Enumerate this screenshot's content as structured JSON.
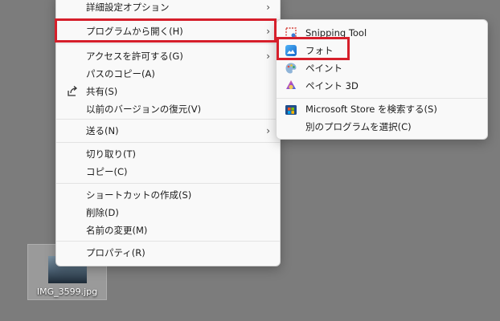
{
  "main_menu": {
    "items": [
      {
        "label": "詳細設定オプション",
        "has_submenu": true
      },
      {
        "label": "プログラムから開く(H)",
        "has_submenu": true
      },
      {
        "label": "アクセスを許可する(G)",
        "has_submenu": true
      },
      {
        "label": "パスのコピー(A)"
      },
      {
        "label": "共有(S)",
        "icon": "share-icon"
      },
      {
        "label": "以前のバージョンの復元(V)"
      },
      {
        "label": "送る(N)",
        "has_submenu": true
      },
      {
        "label": "切り取り(T)"
      },
      {
        "label": "コピー(C)"
      },
      {
        "label": "ショートカットの作成(S)"
      },
      {
        "label": "削除(D)"
      },
      {
        "label": "名前の変更(M)"
      },
      {
        "label": "プロパティ(R)"
      }
    ]
  },
  "submenu": {
    "items": [
      {
        "label": "Snipping Tool",
        "icon": "snipping-tool-icon"
      },
      {
        "label": "フォト",
        "icon": "photos-icon"
      },
      {
        "label": "ペイント",
        "icon": "paint-icon"
      },
      {
        "label": "ペイント 3D",
        "icon": "paint-3d-icon"
      },
      {
        "label": "Microsoft Store を検索する(S)",
        "icon": "microsoft-store-icon"
      },
      {
        "label": "別のプログラムを選択(C)"
      }
    ]
  },
  "desktop_file": {
    "name": "IMG_3599.jpg",
    "icon": "image-thumbnail"
  },
  "colors": {
    "highlight_box": "#d61f2b",
    "desktop_bg": "#7c7c7c",
    "menu_bg": "#f9f9f9"
  }
}
